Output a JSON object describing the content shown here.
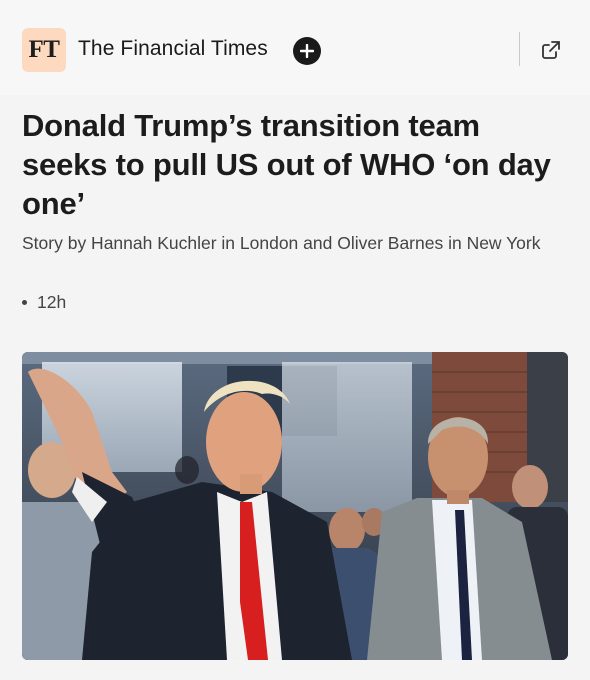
{
  "publisher": {
    "logo_text": "FT",
    "name": "The Financial Times"
  },
  "header_icons": {
    "follow": "plus-circle-icon",
    "open": "external-link-icon"
  },
  "article": {
    "headline": "Donald Trump’s transition team seeks to pull US out of WHO ‘on day one’",
    "byline": "Story by Hannah Kuchler in London and Oliver Barnes in New York",
    "age": "12h"
  },
  "colors": {
    "logo_bg": "#fcd9bf",
    "text": "#1c1c1c",
    "secondary_text": "#444444",
    "background": "#f4f4f4"
  }
}
